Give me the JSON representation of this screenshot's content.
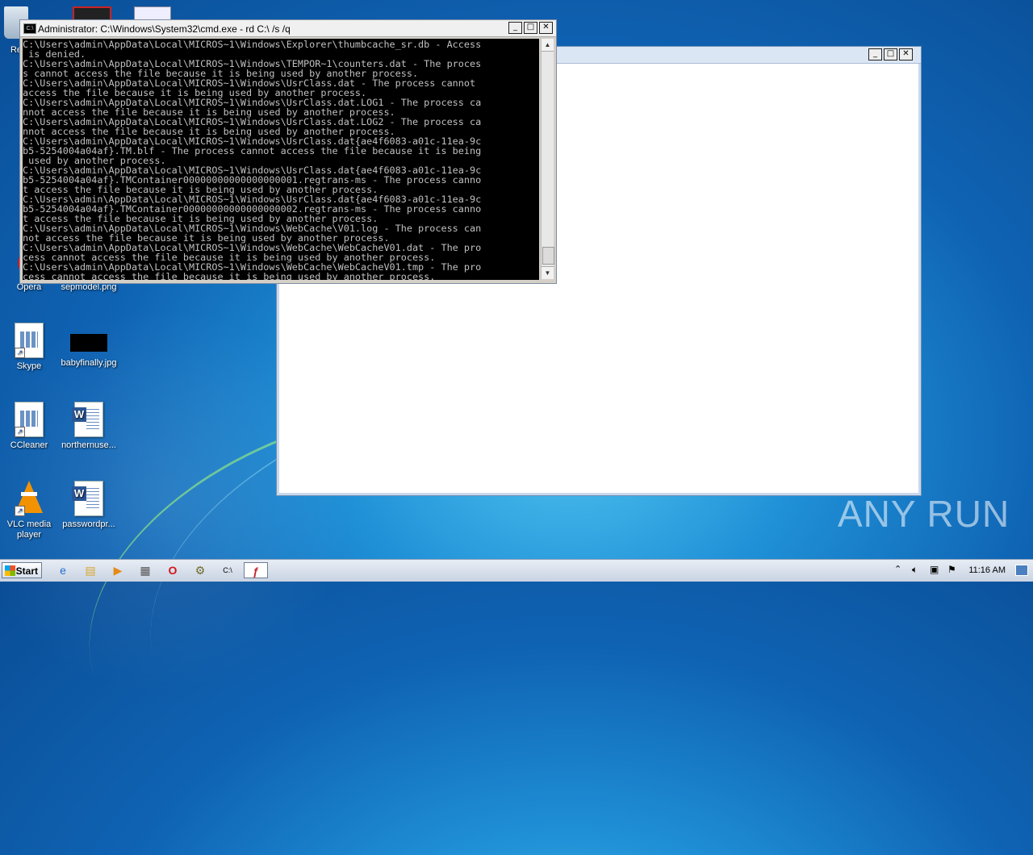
{
  "desktop_icons": [
    {
      "label": "Re",
      "icon": "recycle-bin-icon"
    },
    {
      "label": "Opera",
      "icon": "opera-icon"
    },
    {
      "label": "sepmodel.png",
      "icon": "image-file-icon"
    },
    {
      "label": "Skype",
      "icon": "skype-icon"
    },
    {
      "label": "babyfinally.jpg",
      "icon": "image-file-icon"
    },
    {
      "label": "CCleaner",
      "icon": "ccleaner-icon"
    },
    {
      "label": "northernuse...",
      "icon": "word-doc-icon"
    },
    {
      "label": "VLC media player",
      "icon": "vlc-icon"
    },
    {
      "label": "passwordpr...",
      "icon": "word-doc-icon"
    }
  ],
  "cmd_window": {
    "title": "Administrator: C:\\Windows\\System32\\cmd.exe - rd  C:\\ /s /q",
    "lines": [
      "C:\\Users\\admin\\AppData\\Local\\MICROS~1\\Windows\\Explorer\\thumbcache_sr.db - Access",
      " is denied.",
      "C:\\Users\\admin\\AppData\\Local\\MICROS~1\\Windows\\TEMPOR~1\\counters.dat - The proces",
      "s cannot access the file because it is being used by another process.",
      "C:\\Users\\admin\\AppData\\Local\\MICROS~1\\Windows\\UsrClass.dat - The process cannot",
      "access the file because it is being used by another process.",
      "C:\\Users\\admin\\AppData\\Local\\MICROS~1\\Windows\\UsrClass.dat.LOG1 - The process ca",
      "nnot access the file because it is being used by another process.",
      "C:\\Users\\admin\\AppData\\Local\\MICROS~1\\Windows\\UsrClass.dat.LOG2 - The process ca",
      "nnot access the file because it is being used by another process.",
      "C:\\Users\\admin\\AppData\\Local\\MICROS~1\\Windows\\UsrClass.dat{ae4f6083-a01c-11ea-9c",
      "b5-5254004a04af}.TM.blf - The process cannot access the file because it is being",
      " used by another process.",
      "C:\\Users\\admin\\AppData\\Local\\MICROS~1\\Windows\\UsrClass.dat{ae4f6083-a01c-11ea-9c",
      "b5-5254004a04af}.TMContainer00000000000000000001.regtrans-ms - The process canno",
      "t access the file because it is being used by another process.",
      "C:\\Users\\admin\\AppData\\Local\\MICROS~1\\Windows\\UsrClass.dat{ae4f6083-a01c-11ea-9c",
      "b5-5254004a04af}.TMContainer00000000000000000002.regtrans-ms - The process canno",
      "t access the file because it is being used by another process.",
      "C:\\Users\\admin\\AppData\\Local\\MICROS~1\\Windows\\WebCache\\V01.log - The process can",
      "not access the file because it is being used by another process.",
      "C:\\Users\\admin\\AppData\\Local\\MICROS~1\\Windows\\WebCache\\WebCacheV01.dat - The pro",
      "cess cannot access the file because it is being used by another process.",
      "C:\\Users\\admin\\AppData\\Local\\MICROS~1\\Windows\\WebCache\\WebCacheV01.tmp - The pro",
      "cess cannot access the file because it is being used by another process."
    ]
  },
  "taskbar": {
    "start_label": "Start",
    "items": [
      "ie-icon",
      "explorer-icon",
      "media-player-icon",
      "task-manager-icon",
      "opera-icon",
      "installer-icon",
      "cmd-icon",
      "flash-icon"
    ],
    "clock": "11:16 AM"
  },
  "watermark": "ANY RUN"
}
